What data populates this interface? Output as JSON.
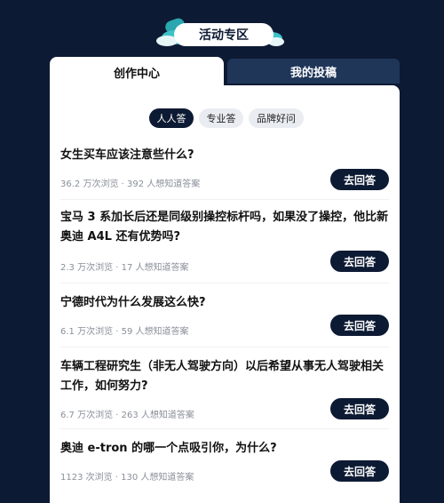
{
  "header": {
    "title": "活动专区"
  },
  "tabs": [
    {
      "label": "创作中心",
      "active": true
    },
    {
      "label": "我的投稿",
      "active": false
    }
  ],
  "filters": [
    {
      "label": "人人答",
      "active": true
    },
    {
      "label": "专业答",
      "active": false
    },
    {
      "label": "品牌好问",
      "active": false
    }
  ],
  "questions": [
    {
      "title": "女生买车应该注意些什么?",
      "meta": "36.2 万次浏览 · 392 人想知道答案",
      "button": "去回答"
    },
    {
      "title": "宝马 3 系加长后还是同级别操控标杆吗，如果没了操控，他比新奥迪 A4L 还有优势吗?",
      "meta": "2.3 万次浏览 · 17 人想知道答案",
      "button": "去回答"
    },
    {
      "title": "宁德时代为什么发展这么快?",
      "meta": "6.1 万次浏览 · 59 人想知道答案",
      "button": "去回答"
    },
    {
      "title": "车辆工程研究生（非无人驾驶方向）以后希望从事无人驾驶相关工作，如何努力?",
      "meta": "6.7 万次浏览 · 263 人想知道答案",
      "button": "去回答"
    },
    {
      "title": "奥迪 e-tron 的哪一个点吸引你，为什么?",
      "meta": "1123 次浏览 · 130 人想知道答案",
      "button": "去回答"
    }
  ],
  "colors": {
    "background": "#0d1a33",
    "accent": "#0d1a33",
    "tab_inactive": "#1f3659"
  }
}
